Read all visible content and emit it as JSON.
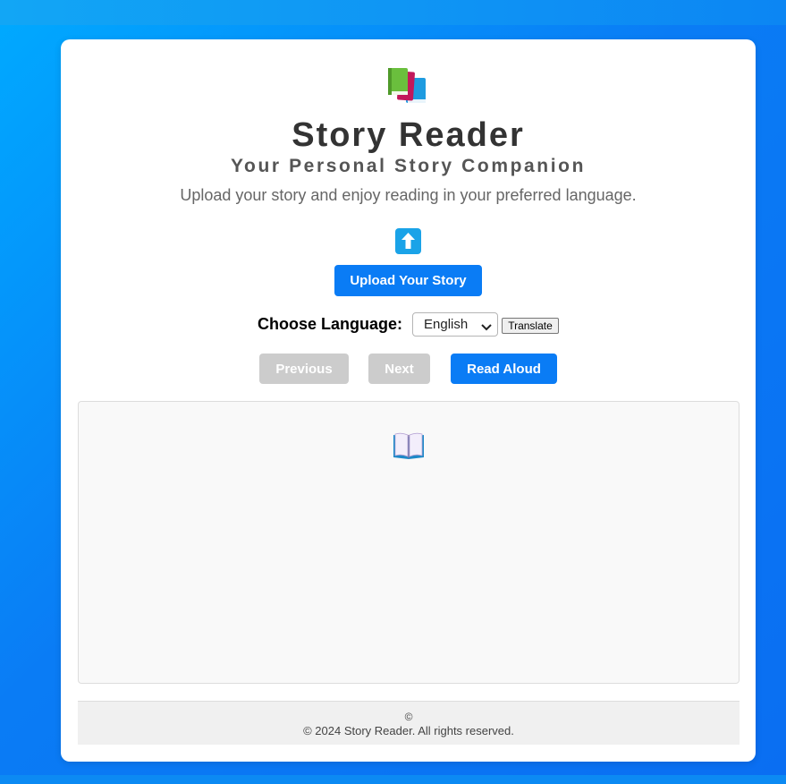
{
  "header": {
    "logo_icon": "books-icon",
    "title": "Story Reader",
    "subtitle": "Your Personal Story Companion",
    "description": "Upload your story and enjoy reading in your preferred language."
  },
  "upload": {
    "icon": "up-arrow-icon",
    "button_label": "Upload Your Story"
  },
  "language": {
    "label": "Choose Language:",
    "selected": "English",
    "translate_label": "Translate"
  },
  "controls": {
    "previous_label": "Previous",
    "next_label": "Next",
    "read_aloud_label": "Read Aloud"
  },
  "story": {
    "icon": "open-book-icon"
  },
  "footer": {
    "symbol": "©",
    "text": "© 2024 Story Reader. All rights reserved."
  },
  "colors": {
    "background": "#0a7cf5",
    "primary_button": "#0a7cf5",
    "disabled_button": "#cccccc",
    "title_text": "#333333"
  }
}
